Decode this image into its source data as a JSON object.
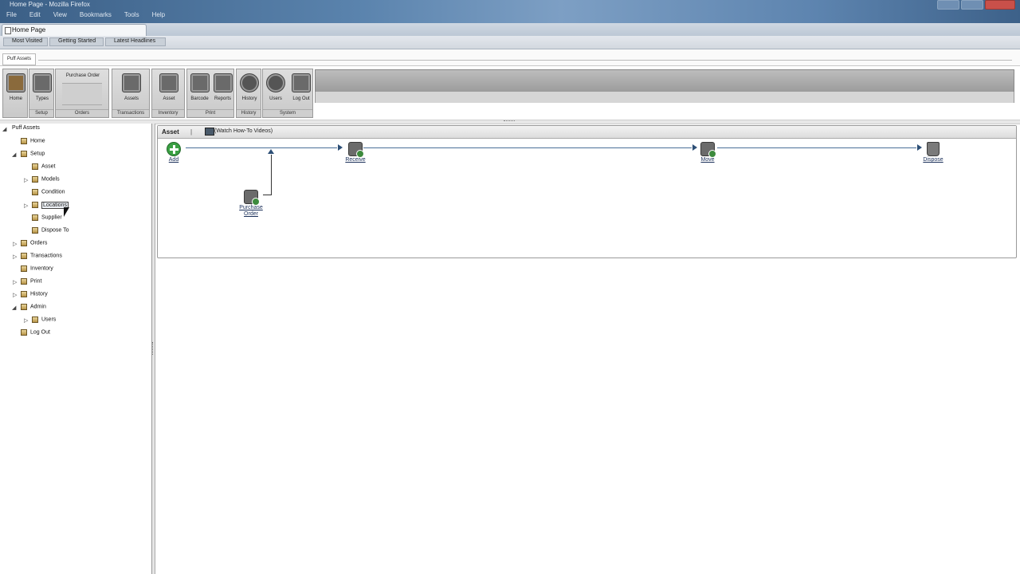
{
  "window": {
    "title": "Home Page - Mozilla Firefox",
    "menu": [
      "File",
      "Edit",
      "View",
      "Bookmarks",
      "Tools",
      "Help"
    ]
  },
  "browser_tab": {
    "label": "Home Page"
  },
  "bookmarks": [
    "Most Visited",
    "Getting Started",
    "Latest Headlines"
  ],
  "app_tab": {
    "label": "Puff Assets"
  },
  "ribbon": {
    "buttons": {
      "home": "Home",
      "types": "Types",
      "purchase_order": "Purchase Order",
      "assets": "Assets",
      "asset": "Asset",
      "barcode": "Barcode",
      "reports": "Reports",
      "history": "History",
      "users": "Users",
      "logout": "Log Out"
    },
    "groups": {
      "setup": "Setup",
      "orders": "Orders",
      "transactions": "Transactions",
      "inventory": "Inventory",
      "print": "Print",
      "history": "History",
      "system": "System"
    }
  },
  "tree": {
    "root": "Puff Assets",
    "items": [
      {
        "label": "Home"
      },
      {
        "label": "Setup"
      },
      {
        "label": "Asset"
      },
      {
        "label": "Models"
      },
      {
        "label": "Condition"
      },
      {
        "label": "Locations"
      },
      {
        "label": "Supplier"
      },
      {
        "label": "Dispose To"
      },
      {
        "label": "Orders"
      },
      {
        "label": "Transactions"
      },
      {
        "label": "Inventory"
      },
      {
        "label": "Print"
      },
      {
        "label": "History"
      },
      {
        "label": "Admin"
      },
      {
        "label": "Users"
      },
      {
        "label": "Log Out"
      }
    ]
  },
  "panel": {
    "title": "Asset",
    "separator": "|",
    "video_link": "(Watch How-To Videos)",
    "steps": {
      "add": "Add",
      "receive": "Receive",
      "move": "Move",
      "dispose": "Dispose",
      "purchase_order_line1": "Purchase",
      "purchase_order_line2": "Order"
    }
  },
  "colors": {
    "accent_green": "#3aa043",
    "link_blue": "#1a2f59",
    "flow_line": "#4a6f98"
  }
}
